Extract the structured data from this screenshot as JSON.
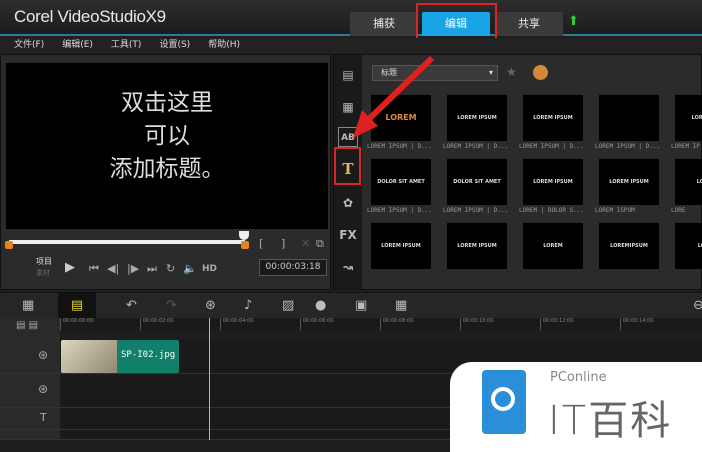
{
  "app": {
    "title": "Corel VideoStudioX9"
  },
  "tabs": [
    {
      "label": "捕获"
    },
    {
      "label": "编辑",
      "active": true
    },
    {
      "label": "共享"
    }
  ],
  "menu": [
    "文件(F)",
    "编辑(E)",
    "工具(T)",
    "设置(S)",
    "帮助(H)"
  ],
  "preview": {
    "lines": [
      "双击这里",
      "可以",
      "添加标题。"
    ],
    "mode_project": "项目",
    "mode_clip": "素材",
    "hd": "HD",
    "timecode": "00:00:03:18"
  },
  "library": {
    "category": "标题",
    "sidebar_icons": [
      "media-icon",
      "instant-project-icon",
      "transition-icon",
      "title-icon",
      "graphic-icon",
      "filter-fx-icon",
      "path-icon"
    ],
    "thumbs": [
      [
        {
          "text": "LOREM IPSUM",
          "label": "LOREM IPSUM | D..."
        },
        {
          "text": "LOREM IPSUM",
          "label": "LOREM IPSUM | D..."
        },
        {
          "text": "LOREM IPSUM",
          "label": "LOREM IPSUM | D..."
        },
        {
          "text": "",
          "label": "LOREM IPSUM | D..."
        },
        {
          "text": "LOREM IP",
          "label": "LOREM IP"
        }
      ],
      [
        {
          "text": "DOLOR SIT AMET",
          "label": "LOREM IPSUM | D..."
        },
        {
          "text": "DOLOR SIT AMET",
          "label": "LOREM IPSUM | D..."
        },
        {
          "text": "LOREM IPSUM",
          "label": "LOREM | DOLOR S..."
        },
        {
          "text": "LOREM IPSUM",
          "label": "LOREM ISPUM"
        },
        {
          "text": "LOREI",
          "label": "LORE"
        }
      ],
      [
        {
          "text": "LOREM IPSUM",
          "label": ""
        },
        {
          "text": "LOREM IPSUM",
          "label": ""
        },
        {
          "text": "LOREM",
          "label": ""
        },
        {
          "text": "LOREMIPSUM",
          "label": ""
        },
        {
          "text": "LORE",
          "label": ""
        }
      ]
    ]
  },
  "timeline": {
    "ruler": [
      "00:00:00:00",
      "00:00:02:00",
      "00:00:04:00",
      "00:00:06:00",
      "00:00:08:00",
      "00:00:10:00",
      "00:00:12:00",
      "00:00:14:00"
    ],
    "clip": "SP-I02.jpg"
  },
  "watermark": {
    "brand": "PConline",
    "name": "IT百科"
  },
  "colors": {
    "accent": "#19a4e6",
    "highlight": "#d9262b"
  }
}
